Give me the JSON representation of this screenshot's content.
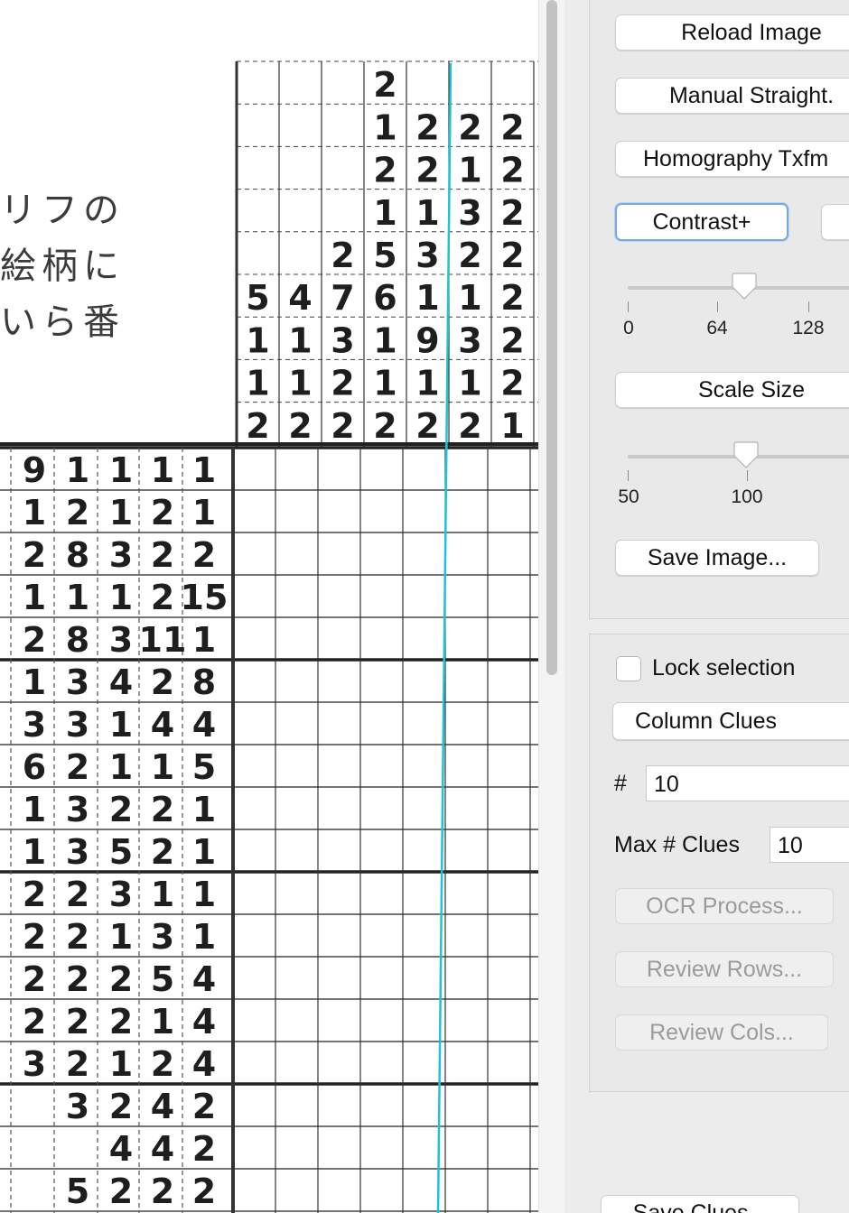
{
  "image": {
    "japanese_lines": [
      "リフの",
      "絵柄に",
      "いら番"
    ],
    "column_clues": [
      [
        null,
        null,
        null,
        null,
        "5",
        "1",
        "1",
        "2"
      ],
      [
        null,
        null,
        null,
        null,
        "4",
        "1",
        "1",
        "2"
      ],
      [
        null,
        null,
        null,
        "2",
        "7",
        "3",
        "2",
        "2"
      ],
      [
        "2",
        "1",
        "2",
        "1",
        "5",
        "6",
        "1",
        "1",
        "2"
      ],
      [
        null,
        "2",
        "2",
        "1",
        "3",
        "1",
        "9",
        "1",
        "2"
      ],
      [
        null,
        "2",
        "1",
        "3",
        "2",
        "1",
        "3",
        "1",
        "2"
      ],
      [
        null,
        "2",
        "2",
        "2",
        "2",
        "2",
        "2",
        "2",
        "1"
      ]
    ],
    "row_clues": [
      [
        "9",
        "1",
        "1",
        "1",
        "1"
      ],
      [
        "1",
        "2",
        "1",
        "2",
        "1"
      ],
      [
        "2",
        "8",
        "3",
        "2",
        "2"
      ],
      [
        "1",
        "1",
        "1",
        "2",
        "15"
      ],
      [
        "2",
        "8",
        "3",
        "11",
        "1"
      ],
      [
        "1",
        "3",
        "4",
        "2",
        "8"
      ],
      [
        "3",
        "3",
        "1",
        "4",
        "4"
      ],
      [
        "6",
        "2",
        "1",
        "1",
        "5"
      ],
      [
        "1",
        "3",
        "2",
        "2",
        "1"
      ],
      [
        "1",
        "3",
        "5",
        "2",
        "1"
      ],
      [
        "2",
        "2",
        "3",
        "1",
        "1"
      ],
      [
        "2",
        "2",
        "1",
        "3",
        "1"
      ],
      [
        "2",
        "2",
        "2",
        "5",
        "4"
      ],
      [
        "2",
        "2",
        "2",
        "1",
        "4"
      ],
      [
        "3",
        "2",
        "1",
        "2",
        "4"
      ],
      [
        "3",
        "2",
        "4",
        "2"
      ],
      [
        "4",
        "4",
        "2"
      ],
      [
        "5",
        "2",
        "2",
        "2"
      ]
    ],
    "guide_line_color": "#1fc4d4"
  },
  "controls": {
    "reload_image": "Reload Image",
    "manual_straight": "Manual Straight.",
    "homography": "Homography Txfm",
    "contrast_plus": "Contrast+",
    "contrast_slider": {
      "ticks": [
        "0",
        "64",
        "128"
      ],
      "value": 80
    },
    "scale_size": "Scale Size",
    "scale_slider": {
      "ticks": [
        "50",
        "100"
      ],
      "value": 100
    },
    "save_image": "Save Image...",
    "lock_selection": "Lock selection",
    "lock_checked": false,
    "clue_type": "Column Clues",
    "number_label": "#",
    "number_value": "10",
    "max_clues_label": "Max # Clues",
    "max_clues_value": "10",
    "ocr_process": "OCR Process...",
    "review_rows": "Review Rows...",
    "review_cols": "Review Cols...",
    "save_clues": "Save Clues..."
  }
}
